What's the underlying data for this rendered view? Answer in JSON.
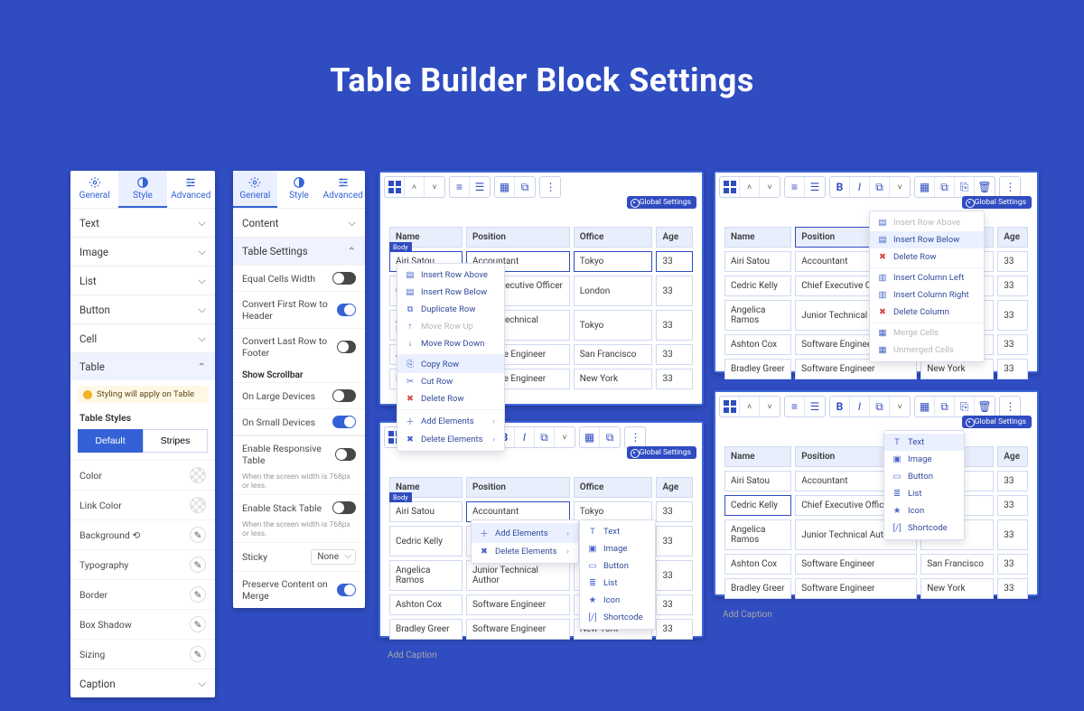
{
  "title": "Table Builder Block Settings",
  "tabs": {
    "general": "General",
    "style": "Style",
    "advanced": "Advanced"
  },
  "panel1": {
    "sections": [
      "Text",
      "Image",
      "List",
      "Button",
      "Cell",
      "Table",
      "Caption"
    ],
    "note": "Styling will apply on Table",
    "styles_label": "Table Styles",
    "buttons": {
      "default": "Default",
      "stripes": "Stripes"
    },
    "props": [
      "Color",
      "Link Color",
      "Background  ⟲",
      "Typography",
      "Border",
      "Box Shadow",
      "Sizing"
    ]
  },
  "panel2": {
    "sections": {
      "content": "Content",
      "table_settings": "Table Settings"
    },
    "rows": {
      "eq": "Equal Cells Width",
      "first": "Convert First Row to Header",
      "last": "Convert Last Row to Footer",
      "scroll_h": "Show Scrollbar",
      "lg": "On Large Devices",
      "sm": "On Small Devices",
      "resp": "Enable Responsive Table",
      "hint": "When the screen width is 768px or less.",
      "stack": "Enable Stack Table",
      "sticky": "Sticky",
      "sticky_val": "None",
      "merge": "Preserve Content on Merge"
    }
  },
  "ed": {
    "global": "Global Settings",
    "cols": [
      "Name",
      "Position",
      "Office",
      "Age"
    ],
    "rows": [
      [
        "Airi Satou",
        "Accountant",
        "Tokyo",
        "33"
      ],
      [
        "Cedric Kelly",
        "Chief Executive Officer (CEO)",
        "London",
        "33"
      ],
      [
        "Angelica Ramos",
        "Junior Technical Author",
        "Tokyo",
        "33"
      ],
      [
        "Ashton Cox",
        "Software Engineer",
        "San Francisco",
        "33"
      ],
      [
        "Bradley Greer",
        "Software Engineer",
        "New York",
        "33"
      ]
    ],
    "rows_short": [
      [
        "Airi Satou",
        "Accountant",
        "Tokyo",
        "33"
      ],
      [
        "Cedric Kelly",
        "Chief Executive Officer",
        "",
        "33"
      ],
      [
        "Angelica Ramos",
        "Junior Technical Author",
        "",
        "33"
      ],
      [
        "Ashton Cox",
        "Software Engineer",
        "San Francisco",
        "33"
      ],
      [
        "Bradley Greer",
        "Software Engineer",
        "New York",
        "33"
      ]
    ],
    "caption": "Add Caption",
    "body": "Body"
  },
  "menu_row": {
    "items": [
      {
        "t": "Insert Row Above"
      },
      {
        "t": "Insert Row Below"
      },
      {
        "t": "Duplicate Row"
      },
      {
        "t": "Move Row Up",
        "muted": true
      },
      {
        "t": "Move Row Down"
      },
      {
        "t": "Copy Row",
        "active": true,
        "sep": true
      },
      {
        "t": "Cut Row"
      },
      {
        "t": "Delete Row",
        "red": true
      },
      {
        "t": "Add Elements",
        "arrow": true,
        "sep": true
      },
      {
        "t": "Delete Elements",
        "arrow": true
      }
    ]
  },
  "menu_add": {
    "top": [
      {
        "t": "Add Elements",
        "arrow": true,
        "active": true
      },
      {
        "t": "Delete Elements",
        "arrow": true
      }
    ],
    "sub": [
      "Text",
      "Image",
      "Button",
      "List",
      "Icon",
      "Shortcode"
    ]
  },
  "menu_col": {
    "items": [
      {
        "t": "Insert Row Above",
        "muted": true
      },
      {
        "t": "Insert Row Below",
        "active": true
      },
      {
        "t": "Delete Row",
        "red": true
      },
      {
        "t": "Insert Column Left",
        "sep": true
      },
      {
        "t": "Insert Column Right"
      },
      {
        "t": "Delete Column",
        "red": true
      },
      {
        "t": "Merge Cells",
        "muted": true,
        "sep": true
      },
      {
        "t": "Unmerged Cells",
        "muted": true
      }
    ]
  }
}
